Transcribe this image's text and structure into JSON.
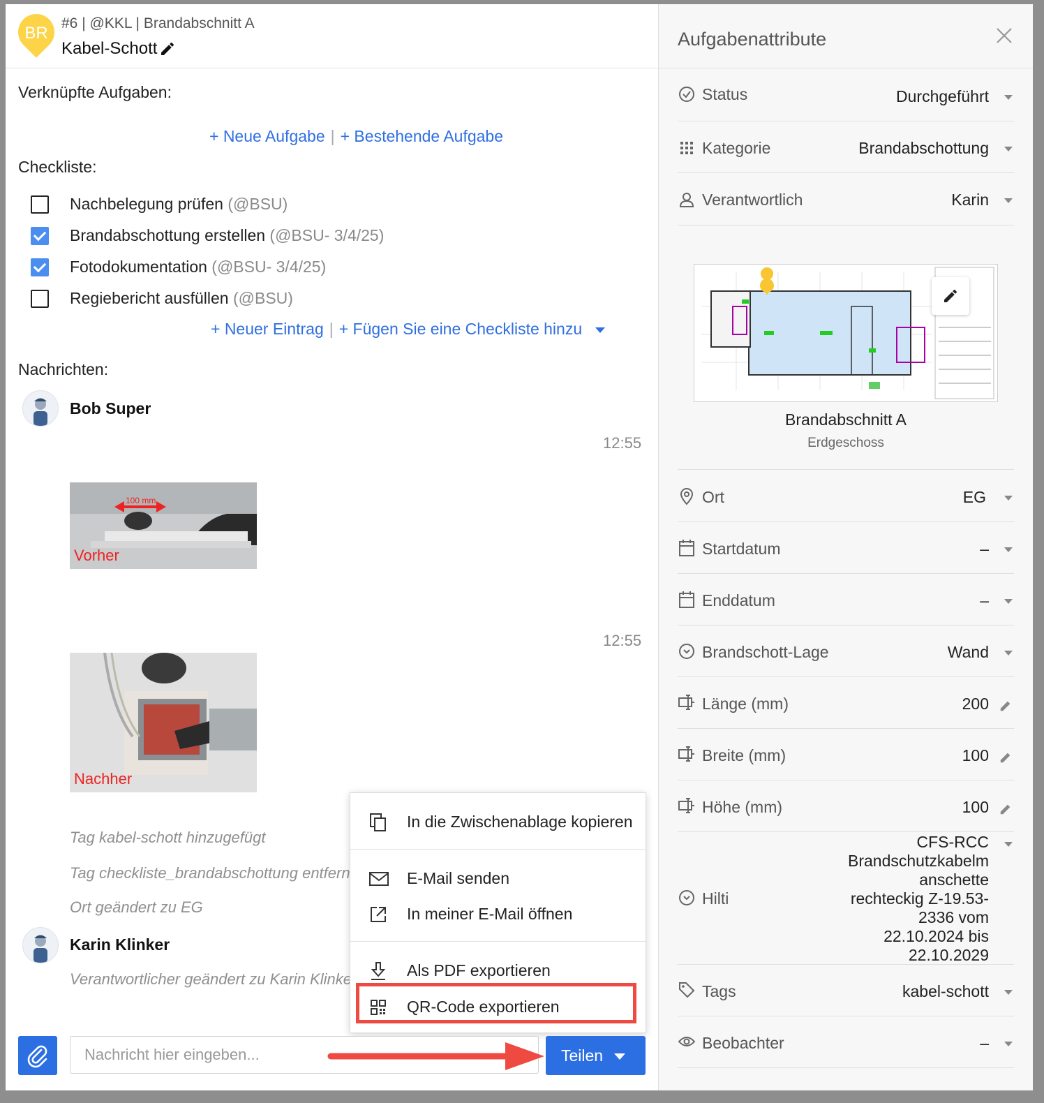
{
  "header": {
    "pin_initials": "BR",
    "breadcrumb": "#6 | @KKL | Brandabschnitt A",
    "title": "Kabel-Schott",
    "pin_color": "#fdd447"
  },
  "linked": {
    "heading": "Verknüpfte Aufgaben:",
    "new_task": "+ Neue Aufgabe",
    "existing_task": "+ Bestehende Aufgabe"
  },
  "checklist": {
    "heading": "Checkliste:",
    "items": [
      {
        "label": "Nachbelegung prüfen",
        "meta": "(@BSU)",
        "checked": false
      },
      {
        "label": "Brandabschottung erstellen",
        "meta": "(@BSU- 3/4/25)",
        "checked": true
      },
      {
        "label": "Fotodokumentation",
        "meta": "(@BSU- 3/4/25)",
        "checked": true
      },
      {
        "label": "Regiebericht ausfüllen",
        "meta": "(@BSU)",
        "checked": false
      }
    ],
    "new_entry": "+ Neuer Eintrag",
    "add_checklist": "+ Fügen Sie eine Checkliste hinzu"
  },
  "messages": {
    "heading": "Nachrichten:",
    "user1": "Bob Super",
    "time1": "12:55",
    "photo1_label": "Vorher",
    "photo1_measure": "100 mm",
    "time2": "12:55",
    "photo2_label": "Nachher",
    "log": [
      "Tag kabel-schott hinzugefügt",
      "Tag checkliste_brandabschottung entfernt",
      "Ort geändert zu EG"
    ],
    "user2": "Karin Klinker",
    "log2": "Verantwortlicher geändert zu Karin Klinker"
  },
  "share_menu": {
    "items": [
      {
        "label": "In die Zwischenablage kopieren",
        "icon": "copy-icon"
      },
      {
        "label": "E-Mail senden",
        "icon": "envelope-icon"
      },
      {
        "label": "In meiner E-Mail öffnen",
        "icon": "external-link-icon"
      },
      {
        "label": "Als PDF exportieren",
        "icon": "download-icon"
      },
      {
        "label": "QR-Code exportieren",
        "icon": "qr-code-icon"
      }
    ],
    "highlight_color": "#ee4a41"
  },
  "composer": {
    "placeholder": "Nachricht hier eingeben...",
    "share_label": "Teilen",
    "accent": "#2b6fe3"
  },
  "attributes": {
    "title": "Aufgabenattribute",
    "status": {
      "label": "Status",
      "value": "Durchgeführt"
    },
    "category": {
      "label": "Kategorie",
      "value": "Brandabschottung"
    },
    "responsible": {
      "label": "Verantwortlich",
      "value": "Karin"
    },
    "plan": {
      "name": "Brandabschnitt A",
      "floor": "Erdgeschoss"
    },
    "location": {
      "label": "Ort",
      "value": "EG"
    },
    "start": {
      "label": "Startdatum",
      "value": "–"
    },
    "end": {
      "label": "Enddatum",
      "value": "–"
    },
    "position": {
      "label": "Brandschott-Lage",
      "value": "Wand"
    },
    "length": {
      "label": "Länge (mm)",
      "value": "200"
    },
    "width": {
      "label": "Breite (mm)",
      "value": "100"
    },
    "height": {
      "label": "Höhe (mm)",
      "value": "100"
    },
    "hilti": {
      "label": "Hilti",
      "value": "CFS-RCC Brandschutzkabelm anschette rechteckig Z-19.53-2336 vom 22.10.2024 bis 22.10.2029"
    },
    "tags": {
      "label": "Tags",
      "value": "kabel-schott"
    },
    "watchers": {
      "label": "Beobachter",
      "value": "–"
    }
  }
}
